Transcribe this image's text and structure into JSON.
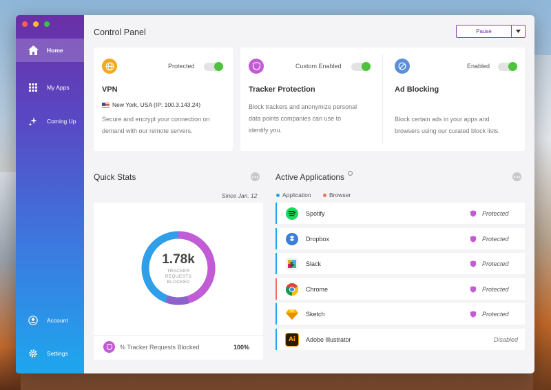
{
  "window": {
    "title": "Control Panel",
    "pause_label": "Pause"
  },
  "sidebar": {
    "items": [
      {
        "label": "Home",
        "icon": "home-icon"
      },
      {
        "label": "My Apps",
        "icon": "grid-icon"
      },
      {
        "label": "Coming Up",
        "icon": "sparkle-icon"
      },
      {
        "label": "Account",
        "icon": "account-icon"
      },
      {
        "label": "Settings",
        "icon": "gear-icon"
      }
    ]
  },
  "features": {
    "vpn": {
      "status": "Protected",
      "title": "VPN",
      "location": "New York, USA (IP: 100.3.143.24)",
      "description_1": "Secure and encrypt your connection on",
      "description_2": "demand with our remote servers.",
      "icon": "globe-icon",
      "color": "#f5a623"
    },
    "tracker": {
      "status": "Custom Enabled",
      "title": "Tracker Protection",
      "description_1": "Block trackers and anonymize personal",
      "description_2": "data points companies can use to",
      "description_3": "identify you.",
      "icon": "shield-icon",
      "color": "#c45bd6"
    },
    "ads": {
      "status": "Enabled",
      "title": "Ad Blocking",
      "description_1": "Block certain ads in your apps and",
      "description_2": "browsers using our curated block lists.",
      "icon": "block-icon",
      "color": "#5b8fd6"
    }
  },
  "quick_stats": {
    "title": "Quick Stats",
    "since": "Since Jan. 12",
    "value": "1.78k",
    "caption_1": "TRACKER",
    "caption_2": "REQUESTS",
    "caption_3": "BLOCKED",
    "footer_label": "% Tracker Requests Blocked",
    "footer_value": "100%"
  },
  "active_apps": {
    "title": "Active Applications",
    "legend_application": "Application",
    "legend_browser": "Browser",
    "apps": [
      {
        "name": "Spotify",
        "status": "Protected",
        "kind": "application"
      },
      {
        "name": "Dropbox",
        "status": "Protected",
        "kind": "application"
      },
      {
        "name": "Slack",
        "status": "Protected",
        "kind": "application"
      },
      {
        "name": "Chrome",
        "status": "Protected",
        "kind": "browser"
      },
      {
        "name": "Sketch",
        "status": "Protected",
        "kind": "application"
      },
      {
        "name": "Adobe Illustrator",
        "status": "Disabled",
        "kind": "application"
      }
    ]
  },
  "colors": {
    "accent": "#6a2fa6",
    "toggle_on": "#4cc33a",
    "application": "#1ea7ee",
    "browser": "#f07060",
    "donut_blue": "#2e9fe8",
    "donut_purple": "#c45bd6"
  }
}
